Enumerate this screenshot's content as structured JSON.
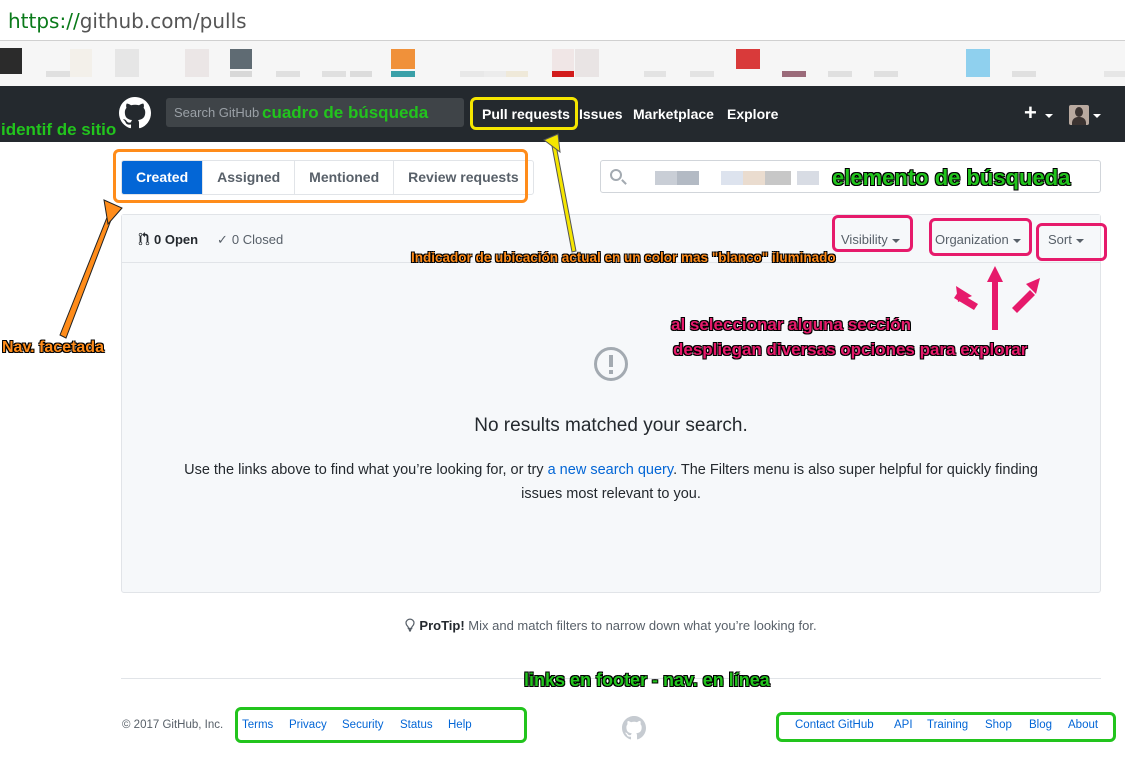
{
  "browser": {
    "url_scheme": "https://",
    "url_rest": "github.com/pulls"
  },
  "header": {
    "search_placeholder": "Search GitHub",
    "nav": [
      "Pull requests",
      "Issues",
      "Marketplace",
      "Explore"
    ],
    "plus_label": "+"
  },
  "tabs": [
    "Created",
    "Assigned",
    "Mentioned",
    "Review requests"
  ],
  "issues": {
    "open_label": "0 Open",
    "closed_label": "0 Closed",
    "filters": [
      "Visibility",
      "Organization",
      "Sort"
    ],
    "blank_title": "No results matched your search.",
    "blank_text_before": "Use the links above to find what you’re looking for, or try ",
    "blank_link": "a new search query",
    "blank_text_after": ". The Filters menu is also super helpful for quickly finding issues most relevant to you."
  },
  "protip": {
    "label": "ProTip!",
    "text": " Mix and match filters to narrow down what you’re looking for."
  },
  "footer": {
    "copyright": "© 2017 GitHub, Inc.",
    "left_links": [
      "Terms",
      "Privacy",
      "Security",
      "Status",
      "Help"
    ],
    "right_links": [
      "Contact GitHub",
      "API",
      "Training",
      "Shop",
      "Blog",
      "About"
    ]
  },
  "annotations": {
    "site_id": "identif de sitio",
    "search_box": "cuadro de búsqueda",
    "search_element": "elemento de búsqueda",
    "location_indicator": "Indicador de ubicación actual en un color mas \"blanco\" iluminado",
    "faceted_nav": "Nav. facetada",
    "explore_line1": "al seleccionar alguna sección",
    "explore_line2": "despliegan diversas opciones para explorar",
    "footer_links": "links en footer - nav. en línea"
  },
  "colors": {
    "header_bg": "#24292e",
    "accent": "#0366d6",
    "annotation_green": "#22c41d",
    "annotation_orange": "#ff8c1a",
    "annotation_pink": "#e61a6b",
    "annotation_yellow": "#f5e600"
  }
}
